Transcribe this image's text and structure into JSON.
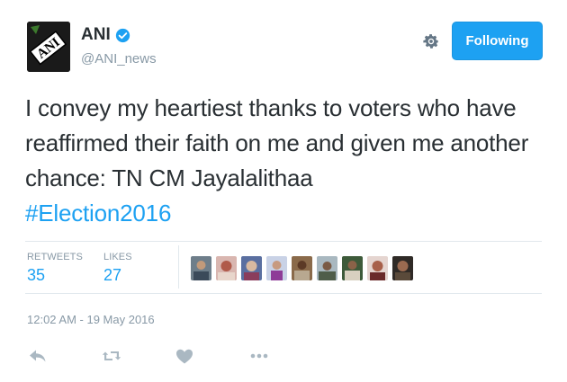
{
  "user": {
    "name": "ANI",
    "handle": "@ANI_news",
    "avatar_text": "ANI",
    "verified": true
  },
  "follow_button": {
    "label": "Following"
  },
  "tweet": {
    "text": "I convey my heartiest thanks to voters who have reaffirmed their faith on me and given me another chance: TN CM Jayalalithaa",
    "hashtag": "#Election2016"
  },
  "stats": {
    "retweets_label": "RETWEETS",
    "retweets_value": "35",
    "likes_label": "LIKES",
    "likes_value": "27"
  },
  "timestamp": "12:02 AM - 19 May 2016",
  "liker_avatar_count": 9,
  "icons": {
    "gear": "gear-icon",
    "reply": "reply-icon",
    "retweet": "retweet-icon",
    "like": "heart-icon",
    "more": "more-icon"
  },
  "colors": {
    "accent": "#1da1f2",
    "text": "#292f33",
    "muted": "#8899a6",
    "divider": "#e1e8ed"
  }
}
